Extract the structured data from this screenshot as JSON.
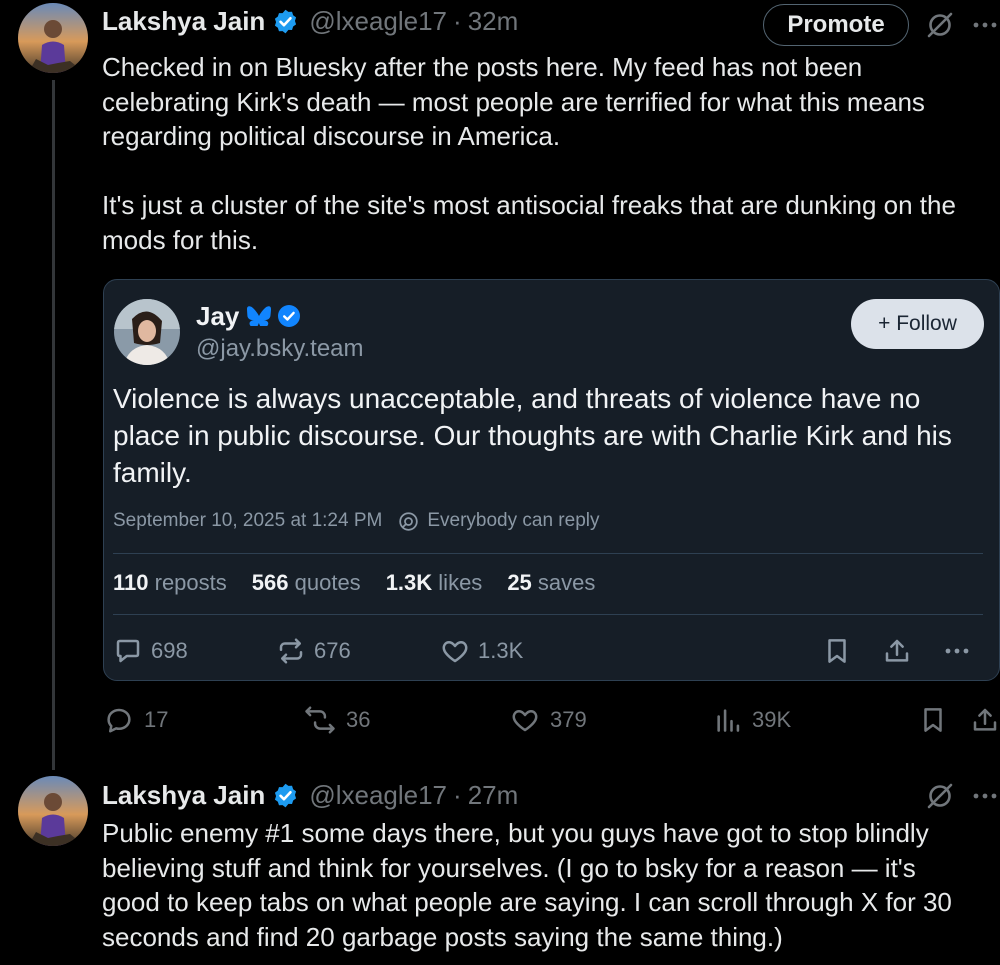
{
  "tweet1": {
    "author": "Lakshya Jain",
    "handle": "@lxeagle17",
    "separator": "·",
    "time": "32m",
    "promote_label": "Promote",
    "text": "Checked in on Bluesky after the posts here. My feed has not been\ncelebrating Kirk's death — most people are terrified for what this means\nregarding political discourse in America.\n\nIt's just a cluster of the site's most antisocial freaks that are dunking on the\nmods for this.",
    "actions": {
      "replies": "17",
      "reposts": "36",
      "likes": "379",
      "views": "39K"
    }
  },
  "embed": {
    "author": "Jay",
    "handle": "@jay.bsky.team",
    "follow_label": "+ Follow",
    "text": "Violence is always unacceptable, and threats of violence have no place in public discourse. Our thoughts are with Charlie Kirk and his family.",
    "timestamp": "September 10, 2025 at 1:24 PM",
    "reply_setting": "Everybody can reply",
    "stats": [
      {
        "value": "110",
        "label": "reposts"
      },
      {
        "value": "566",
        "label": "quotes"
      },
      {
        "value": "1.3K",
        "label": "likes"
      },
      {
        "value": "25",
        "label": "saves"
      }
    ],
    "actions": {
      "replies": "698",
      "reposts": "676",
      "likes": "1.3K"
    }
  },
  "tweet2": {
    "author": "Lakshya Jain",
    "handle": "@lxeagle17",
    "separator": "·",
    "time": "27m",
    "text": "Public enemy #1 some days there, but you guys have got to stop blindly\nbelieving stuff and think for yourselves. (I go to bsky for a reason — it's\ngood to keep tabs on what people are saying. I can scroll through X for 30\nseconds and find 20 garbage posts saying the same thing.)"
  },
  "colors": {
    "background": "#000000",
    "text": "#e7e9ea",
    "secondary": "#71767b",
    "verified": "#1d9bf0",
    "bluesky_blue": "#1185fe",
    "card_bg": "#161e27"
  },
  "icons": [
    "verified-badge-icon",
    "grok-icon",
    "more-icon",
    "butterfly-icon",
    "reply-icon",
    "repost-icon",
    "like-icon",
    "views-icon",
    "bookmark-icon",
    "share-icon",
    "globe-icon"
  ]
}
